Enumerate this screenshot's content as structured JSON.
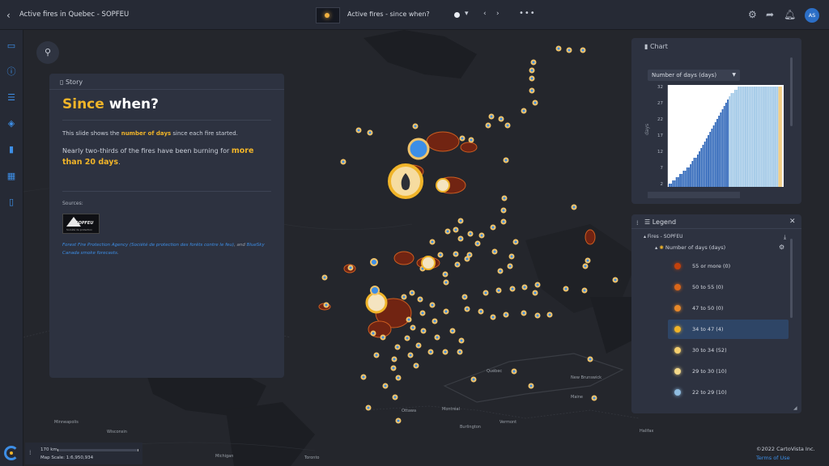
{
  "app": {
    "title": "Active fires in Quebec - SOPFEU",
    "back_icon": "chevron-left-icon"
  },
  "slide": {
    "title": "Active fires - since when?"
  },
  "topbar": {
    "more_label": "•••",
    "prev_label": "‹",
    "next_label": "›",
    "user_initials": "AS",
    "icons": [
      "gear-icon",
      "share-icon",
      "bell-icon"
    ]
  },
  "rail": {
    "icons": [
      "map-icon",
      "info-icon",
      "list-icon",
      "layers-icon",
      "chart-icon",
      "table-icon",
      "book-icon"
    ]
  },
  "story": {
    "header": "Story",
    "title_highlight": "Since",
    "title_rest": " when?",
    "p1_pre": "This slide shows the ",
    "p1_bold": "number of days",
    "p1_post": " since each fire started.",
    "p2_pre": "Nearly two-thirds of the fires have been burning for ",
    "p2_bold": "more than 20 days",
    "p2_post": ".",
    "sources_label": "Sources:",
    "logo_text": "SOPFEU",
    "logo_sub": "Société de protection",
    "src_link1": "Forest Fire Protection Agency (Société de protection des forêts contre le feu)",
    "src_mid": ", and ",
    "src_link2": "BlueSky Canada smoke forecasts",
    "src_end": "."
  },
  "chart": {
    "header": "Chart",
    "selector": "Number of days (days)",
    "ylabel": "days",
    "yticks": [
      "32",
      "27",
      "22",
      "17",
      "12",
      "7",
      "2"
    ]
  },
  "chart_data": {
    "type": "bar",
    "ylabel": "days",
    "ylim": [
      2,
      32
    ],
    "bars": [
      2,
      2,
      3,
      3,
      4,
      4,
      5,
      5,
      6,
      6,
      7,
      7,
      8,
      9,
      10,
      10,
      11,
      12,
      13,
      14,
      15,
      16,
      17,
      18,
      19,
      20,
      21,
      22,
      23,
      24,
      25,
      26,
      27,
      28,
      29,
      30,
      30,
      31,
      31,
      32,
      32,
      32,
      32,
      32,
      32,
      32,
      32,
      32,
      32,
      32,
      32,
      32,
      32,
      32,
      32,
      32,
      32,
      32,
      32,
      32,
      32,
      32,
      32,
      32
    ],
    "colors": {
      "low": "#2b64b8",
      "mid": "#9fc7e6",
      "high": "#f0c36a"
    }
  },
  "legend": {
    "header": "Legend",
    "layer": "Fires - SOPFEU",
    "sublayer": "Number of days (days)",
    "items": [
      {
        "label": "55 or more (0)",
        "color": "#c2410c"
      },
      {
        "label": "50 to 55 (0)",
        "color": "#d9661a"
      },
      {
        "label": "47 to 50 (0)",
        "color": "#e8892a"
      },
      {
        "label": "34 to 47 (4)",
        "color": "#f0b429"
      },
      {
        "label": "30 to 34 (52)",
        "color": "#f4cf6e"
      },
      {
        "label": "29 to 30 (10)",
        "color": "#f4d98a"
      },
      {
        "label": "22 to 29 (10)",
        "color": "#8fbce0"
      }
    ]
  },
  "map": {
    "labels": [
      {
        "text": "Québec",
        "pos": [
          601,
          456
        ]
      },
      {
        "text": "Ottawa",
        "pos": [
          496,
          507
        ]
      },
      {
        "text": "Montréal",
        "pos": [
          546,
          505
        ]
      },
      {
        "text": "Toronto",
        "pos": [
          376,
          565
        ]
      },
      {
        "text": "Wisconsin",
        "pos": [
          132,
          533
        ]
      },
      {
        "text": "Minneapolis",
        "pos": [
          67,
          521
        ]
      },
      {
        "text": "Michigan",
        "pos": [
          266,
          563
        ]
      },
      {
        "text": "Vermont",
        "pos": [
          617,
          521
        ]
      },
      {
        "text": "Maine",
        "pos": [
          705,
          490
        ]
      },
      {
        "text": "New Brunswick",
        "pos": [
          705,
          466
        ]
      },
      {
        "text": "Halifax",
        "pos": [
          790,
          532
        ]
      },
      {
        "text": "Burlington",
        "pos": [
          568,
          527
        ]
      }
    ]
  },
  "scale": {
    "km": "170 km",
    "text": "Map Scale: 1:6,950,934"
  },
  "footer": {
    "copyright": "©2022 CartoVista Inc.",
    "terms": "Terms of Use"
  }
}
